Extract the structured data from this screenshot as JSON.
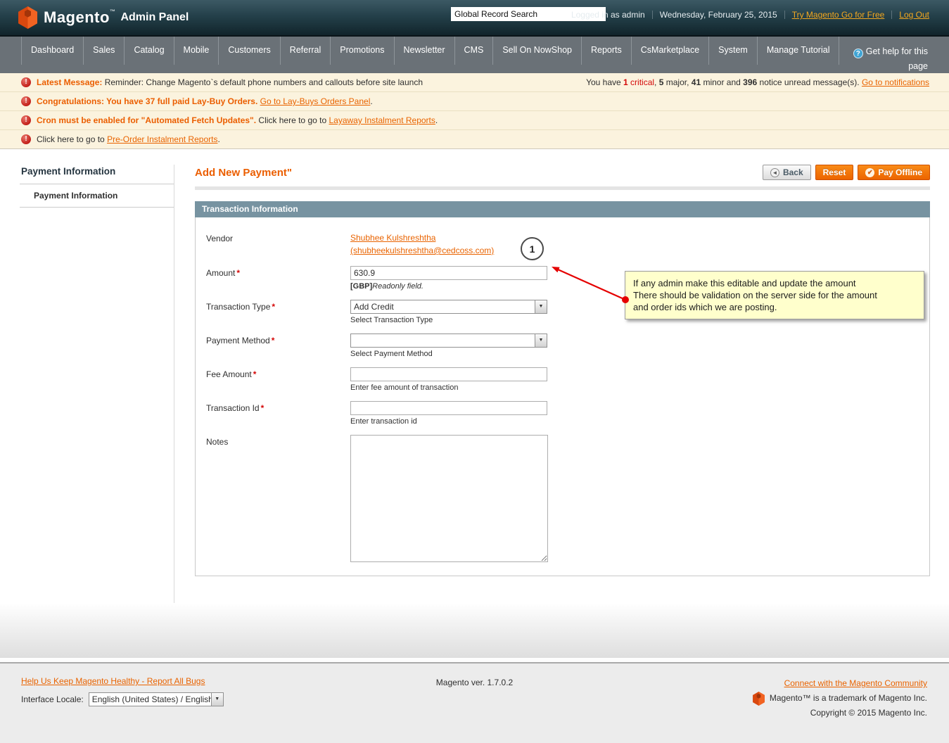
{
  "icons": {
    "help": "?",
    "warning": "!",
    "back_arrow": "◄",
    "check": "✔",
    "dropdown": "▼"
  },
  "header": {
    "logo_name": "Magento",
    "logo_tm": "™",
    "logo_suffix": "Admin Panel",
    "search_value": "Global Record Search",
    "logged_in": "Logged in as admin",
    "date": "Wednesday, February 25, 2015",
    "try_link": "Try Magento Go for Free",
    "logout_link": "Log Out"
  },
  "nav": {
    "items": [
      "Dashboard",
      "Sales",
      "Catalog",
      "Mobile",
      "Customers",
      "Referral",
      "Promotions",
      "Newsletter",
      "CMS",
      "Sell On NowShop",
      "Reports",
      "CsMarketplace",
      "System",
      "Manage Tutorial"
    ],
    "help_label": "Get help for this page"
  },
  "messages": {
    "rows": [
      {
        "lead": "Latest Message:",
        "text": " Reminder: Change Magento`s default phone numbers and callouts before site launch",
        "link": "",
        "suffix": ""
      },
      {
        "lead": "Congratulations: You have 37 full paid Lay-Buy Orders.",
        "text": " ",
        "link": "Go to Lay-Buys Orders Panel",
        "suffix": "."
      },
      {
        "lead": "Cron must be enabled for \"Automated Fetch Updates\".",
        "text": " Click here to go to ",
        "link": "Layaway Instalment Reports",
        "suffix": "."
      },
      {
        "lead": "",
        "text": "Click here to go to ",
        "link": "Pre-Order Instalment Reports",
        "suffix": "."
      }
    ],
    "summary": {
      "prefix": "You have ",
      "critical_num": "1",
      "critical_word": " critical",
      "mid1": ", ",
      "major_num": "5",
      "mid2": " major, ",
      "minor_num": "41",
      "mid3": " minor and ",
      "notice_num": "396",
      "mid4": " notice unread message(s). ",
      "link": "Go to notifications"
    }
  },
  "sidebar": {
    "title": "Payment Information",
    "items": [
      {
        "label": "Payment Information"
      }
    ]
  },
  "main": {
    "title": "Add New Payment\"",
    "buttons": {
      "back": "Back",
      "reset": "Reset",
      "pay_offline": "Pay Offline"
    },
    "panel_title": "Transaction Information",
    "required_mark": "*",
    "form": {
      "vendor": {
        "label": "Vendor",
        "link_line1": "Shubhee Kulshreshtha",
        "link_line2": "(shubheekulshreshtha@cedcoss.com)"
      },
      "amount": {
        "label": "Amount",
        "value": "630.9",
        "note_bold": "[GBP]",
        "note_italic": "Readonly field."
      },
      "transaction_type": {
        "label": "Transaction Type",
        "value": "Add Credit",
        "note": "Select Transaction Type"
      },
      "payment_method": {
        "label": "Payment Method",
        "value": "",
        "note": "Select Payment Method"
      },
      "fee_amount": {
        "label": "Fee Amount",
        "value": "",
        "note": "Enter fee amount of transaction"
      },
      "transaction_id": {
        "label": "Transaction Id",
        "value": "",
        "note": "Enter transaction id"
      },
      "notes": {
        "label": "Notes",
        "value": ""
      }
    }
  },
  "annotation": {
    "number": "1",
    "note": "If any admin make this editable and update the amount\nThere should be validation on the server side for the amount\nand order ids which we are posting.",
    "arrow_color": "#e50000",
    "box_color": "#ffffcc"
  },
  "footer": {
    "bugs_link": "Help Us Keep Magento Healthy - Report All Bugs",
    "locale_label": "Interface Locale:",
    "locale_value": "English (United States) / English",
    "version": "Magento ver. 1.7.0.2",
    "community_link": "Connect with the Magento Community",
    "trademark": "Magento™ is a trademark of Magento Inc.",
    "copyright": "Copyright © 2015 Magento Inc."
  },
  "colors": {
    "accent_orange": "#eb5e00",
    "panel_header": "#7793a1",
    "message_bg": "#fbf3de"
  }
}
